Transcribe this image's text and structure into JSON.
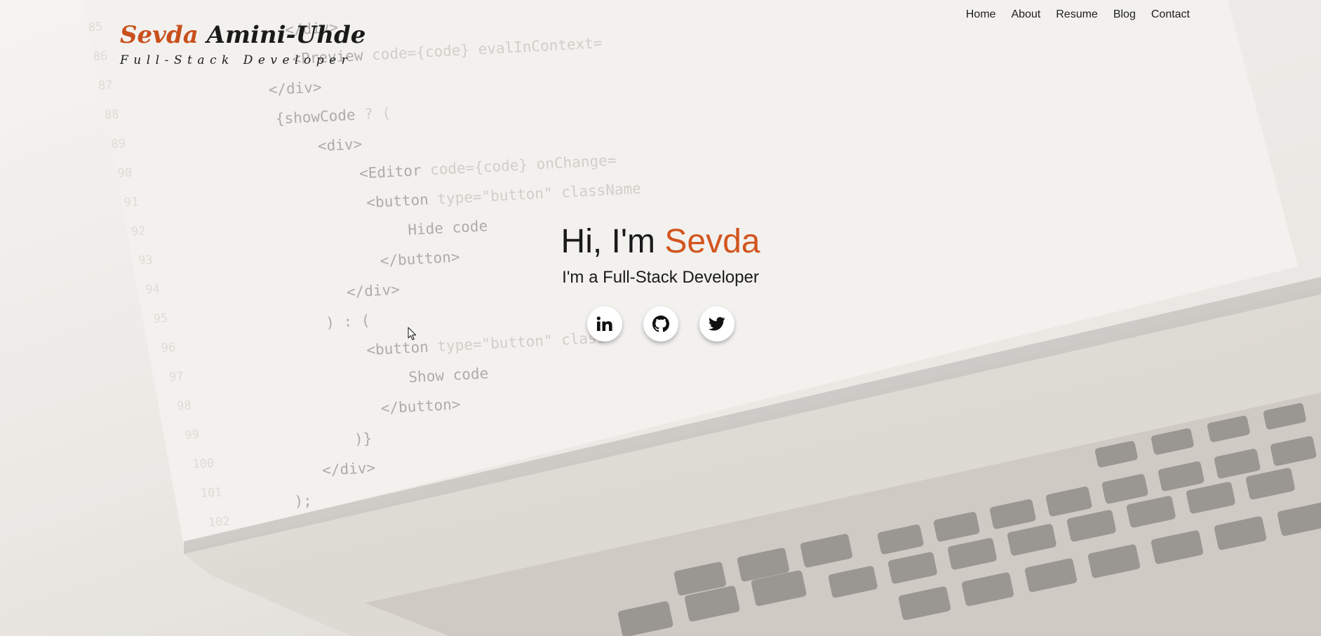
{
  "brand": {
    "first_name": "Sevda",
    "last_name": "Amini-Uhde",
    "tagline": "Full-Stack Developer"
  },
  "nav": {
    "items": [
      "Home",
      "About",
      "Resume",
      "Blog",
      "Contact"
    ]
  },
  "hero": {
    "greeting": "Hi, I'm",
    "name": "Sevda",
    "subtitle": "I'm a Full-Stack Developer"
  },
  "socials": [
    {
      "icon": "linkedin-icon"
    },
    {
      "icon": "github-icon"
    },
    {
      "icon": "twitter-icon"
    }
  ],
  "colors": {
    "accent": "#d2551e",
    "text": "#1a1a1a"
  }
}
